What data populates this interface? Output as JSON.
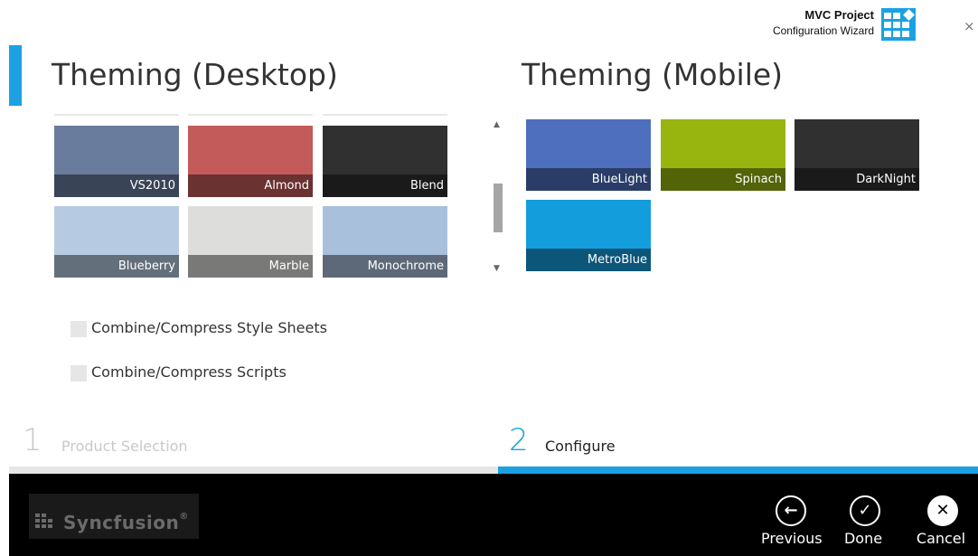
{
  "header": {
    "brand_title": "MVC Project",
    "brand_subtitle": "Configuration Wizard",
    "close_glyph": "×",
    "accent_color": "#1ba1e2"
  },
  "desktop": {
    "title": "Theming (Desktop)",
    "themes": [
      {
        "label": "VS2010",
        "color": "#6a7c9e"
      },
      {
        "label": "Almond",
        "color": "#c25b59"
      },
      {
        "label": "Blend",
        "color": "#303030"
      },
      {
        "label": "Blueberry",
        "color": "#b6cbe2"
      },
      {
        "label": "Marble",
        "color": "#dddddb"
      },
      {
        "label": "Monochrome",
        "color": "#a9c0dc"
      }
    ],
    "options": [
      {
        "label": "Combine/Compress Style Sheets",
        "checked": false
      },
      {
        "label": "Combine/Compress Scripts",
        "checked": false
      }
    ]
  },
  "mobile": {
    "title": "Theming (Mobile)",
    "themes": [
      {
        "label": "BlueLight",
        "color": "#4e6fbe"
      },
      {
        "label": "Spinach",
        "color": "#98b50f"
      },
      {
        "label": "DarkNight",
        "color": "#303030"
      },
      {
        "label": "MetroBlue",
        "color": "#149ddc"
      }
    ]
  },
  "scrollbar": {
    "up_glyph": "▲",
    "down_glyph": "▼"
  },
  "steps": [
    {
      "number": "1",
      "label": "Product Selection",
      "active": false
    },
    {
      "number": "2",
      "label": "Configure",
      "active": true
    }
  ],
  "footer": {
    "logo_text": "Syncfusion",
    "logo_trademark": "®",
    "actions": [
      {
        "label": "Previous",
        "icon": "arrow-left-circle-icon",
        "glyph": "←"
      },
      {
        "label": "Done",
        "icon": "check-circle-icon",
        "glyph": "✓"
      },
      {
        "label": "Cancel",
        "icon": "close-circle-icon",
        "glyph": "✕"
      }
    ]
  }
}
